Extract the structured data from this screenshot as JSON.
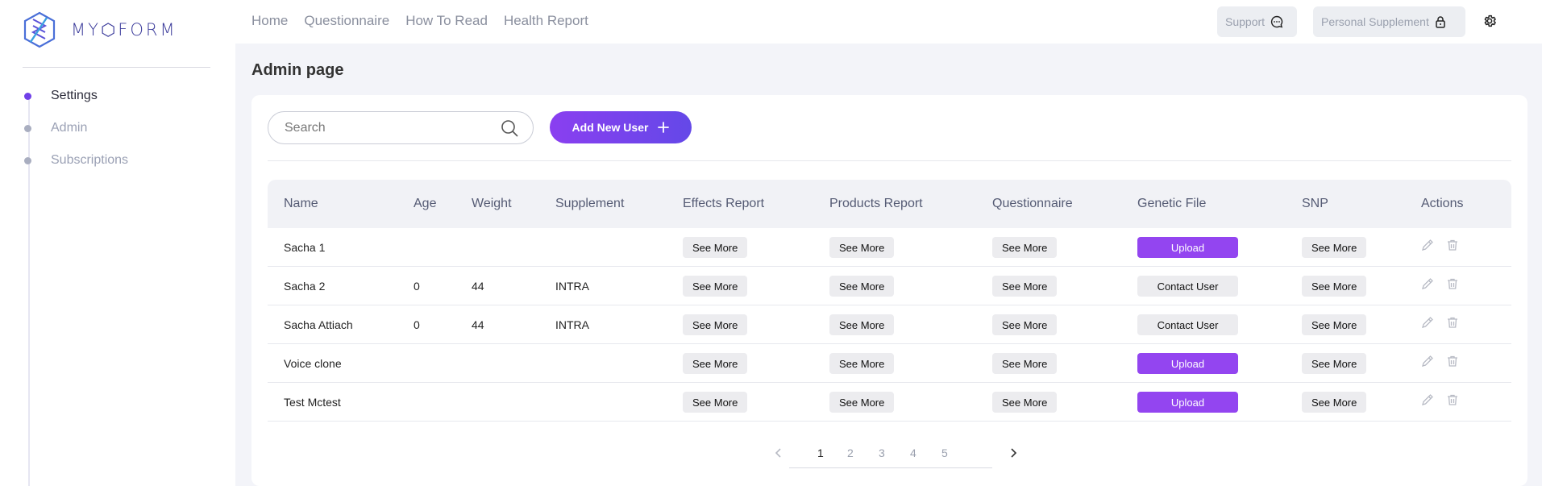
{
  "brand": {
    "name": "MY⬡FORM"
  },
  "sidebar": {
    "items": [
      {
        "label": "Settings"
      },
      {
        "label": "Admin"
      },
      {
        "label": "Subscriptions"
      }
    ]
  },
  "topnav": {
    "items": [
      {
        "label": "Home"
      },
      {
        "label": "Questionnaire"
      },
      {
        "label": "How To Read"
      },
      {
        "label": "Health Report"
      }
    ],
    "support_label": "Support",
    "supplement_label": "Personal Supplement"
  },
  "page": {
    "title": "Admin page"
  },
  "search": {
    "placeholder": "Search",
    "value": ""
  },
  "toolbar": {
    "add_user_label": "Add New User"
  },
  "table": {
    "columns": [
      "Name",
      "Age",
      "Weight",
      "Supplement",
      "Effects Report",
      "Products Report",
      "Questionnaire",
      "Genetic File",
      "SNP",
      "Actions"
    ],
    "see_more_label": "See More",
    "rows": [
      {
        "name": "Sacha 1",
        "age": "",
        "weight": "",
        "supplement": "",
        "genetic": "Upload"
      },
      {
        "name": "Sacha 2",
        "age": "0",
        "weight": "44",
        "supplement": "INTRA",
        "genetic": "Contact User"
      },
      {
        "name": "Sacha Attiach",
        "age": "0",
        "weight": "44",
        "supplement": "INTRA",
        "genetic": "Contact User"
      },
      {
        "name": "Voice clone",
        "age": "",
        "weight": "",
        "supplement": "",
        "genetic": "Upload"
      },
      {
        "name": "Test Mctest",
        "age": "",
        "weight": "",
        "supplement": "",
        "genetic": "Upload"
      }
    ]
  },
  "pagination": {
    "pages": [
      "1",
      "2",
      "3",
      "4",
      "5"
    ],
    "current": "1"
  },
  "colors": {
    "accent": "#8a3ff0",
    "upload": "#9345f0",
    "active_dot": "#7040e8",
    "background": "#f3f4f9"
  },
  "icons": [
    "logo-icon",
    "chat-icon",
    "lock-icon",
    "gear-icon",
    "search-icon",
    "plus-icon",
    "edit-icon",
    "trash-icon",
    "chevron-left-icon",
    "chevron-right-icon"
  ]
}
